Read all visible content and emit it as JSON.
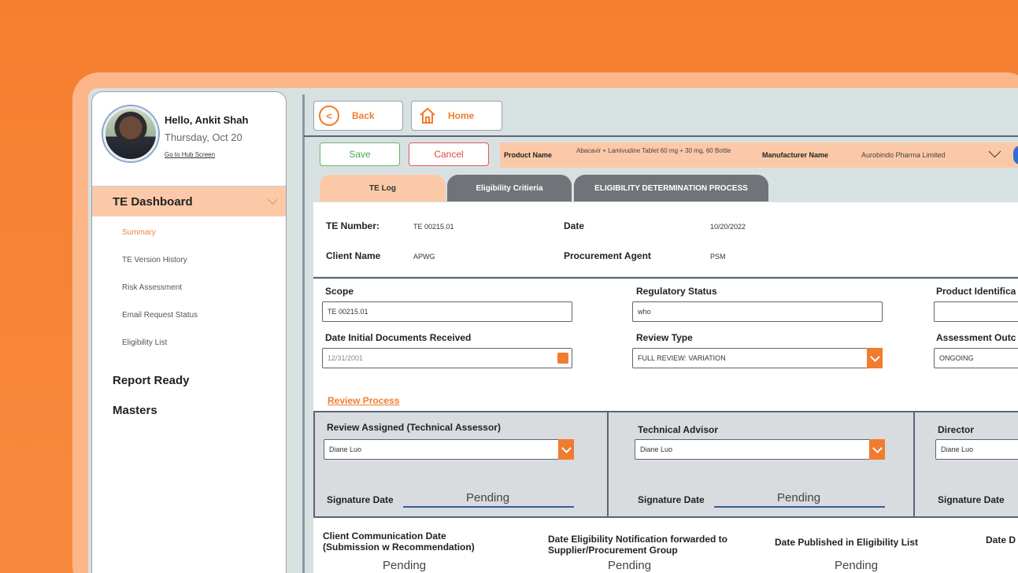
{
  "profile": {
    "greeting": "Hello, Ankit Shah",
    "date": "Thursday, Oct 20",
    "hub_link": "Go to Hub Screen"
  },
  "sidebar": {
    "active_section": "TE Dashboard",
    "sub_items": [
      "Summary",
      "TE Version History",
      "Risk Assessment",
      "Email Request Status",
      "Eligibility List"
    ],
    "sections": [
      "Report Ready",
      "Masters"
    ]
  },
  "nav": {
    "back": "Back",
    "home": "Home"
  },
  "actions": {
    "save": "Save",
    "cancel": "Cancel"
  },
  "product_bar": {
    "product_label": "Product Name",
    "product_value": "Abacavir + Lamivudine Tablet 60 mg + 30 mg, 60 Bottle",
    "manufacturer_label": "Manufacturer Name",
    "manufacturer_value": "Aurobindo Pharma Limited"
  },
  "tabs": [
    "TE Log",
    "Eligibility Critieria",
    "ELIGIBILITY DETERMINATION PROCESS"
  ],
  "te_log": {
    "te_number_label": "TE Number:",
    "te_number": "TE 00215.01",
    "date_label": "Date",
    "date": "10/20/2022",
    "client_label": "Client Name",
    "client": "APWG",
    "agent_label": "Procurement Agent",
    "agent": "PSM"
  },
  "form": {
    "scope_label": "Scope",
    "scope": "TE 00215.01",
    "reg_label": "Regulatory Status",
    "reg": "who",
    "prod_id_label": "Product Identifica",
    "doc_date_label": "Date Initial Documents Received",
    "doc_date": "12/31/2001",
    "review_type_label": "Review Type",
    "review_type": "FULL REVIEW: VARIATION",
    "outcome_label": "Assessment Outc",
    "outcome": "ONGOING"
  },
  "review": {
    "link": "Review Process",
    "assessor_label": "Review Assigned (Technical Assessor)",
    "advisor_label": "Technical Advisor",
    "director_label": "Director",
    "assignee": "Diane Luo",
    "sig_label": "Signature Date",
    "pending": "Pending"
  },
  "footer": {
    "client_comm": "Client Communication Date (Submission w Recommendation)",
    "notif": "Date Eligibility Notification forwarded to Supplier/Procurement Group",
    "published": "Date Published in Eligibility List",
    "date_d": "Date D",
    "pending": "Pending"
  },
  "colors": {
    "accent": "#f07c2e",
    "peach": "#fbc9a8",
    "background": "#f57f2f"
  }
}
